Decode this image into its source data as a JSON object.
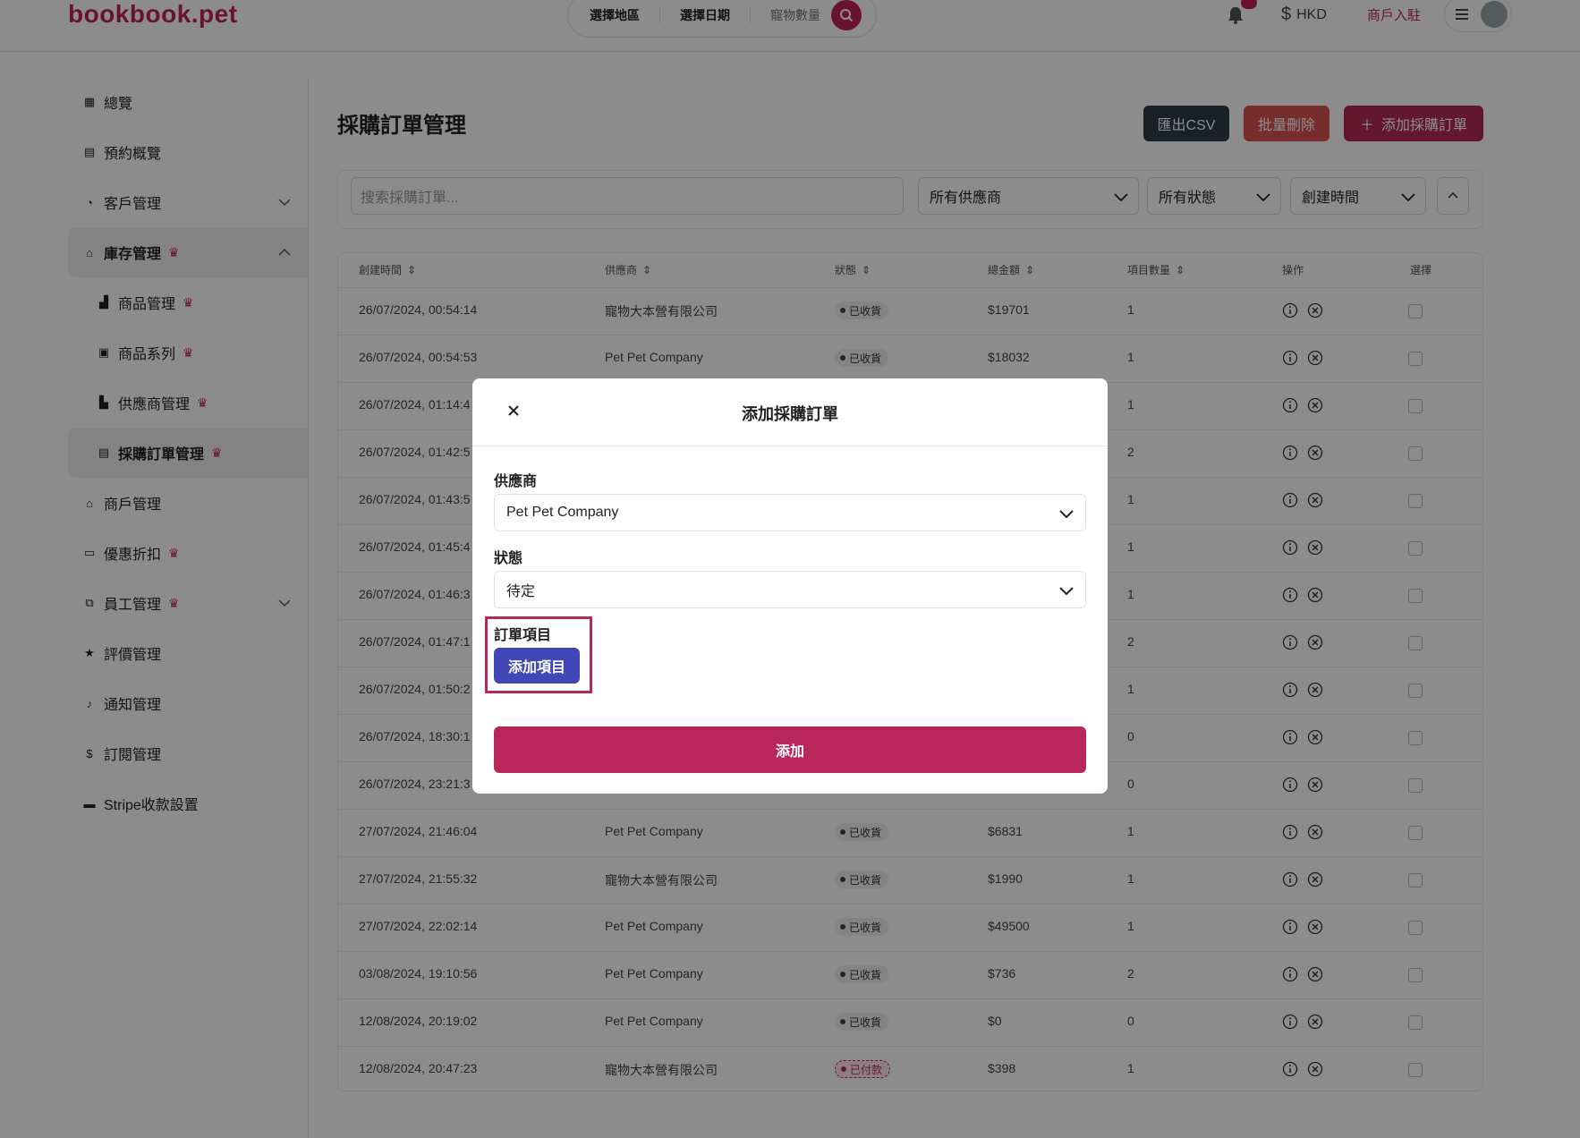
{
  "header": {
    "logo": "bookbook.pet",
    "search": {
      "area": "選擇地區",
      "date": "選擇日期",
      "pets": "寵物數量"
    },
    "currency": "HKD",
    "merchant_link": "商戶入駐"
  },
  "sidebar": {
    "items": [
      {
        "label": "總覽",
        "icon": "grid-icon"
      },
      {
        "label": "預約概覽",
        "icon": "calendar-icon"
      },
      {
        "label": "客戶管理",
        "icon": "headset-icon"
      },
      {
        "label": "庫存管理",
        "icon": "store-icon"
      },
      {
        "label": "商品管理",
        "icon": "boxes-icon"
      },
      {
        "label": "商品系列",
        "icon": "archive-icon"
      },
      {
        "label": "供應商管理",
        "icon": "factory-icon"
      },
      {
        "label": "採購訂單管理",
        "icon": "calendar-icon"
      },
      {
        "label": "商戶管理",
        "icon": "store-icon"
      },
      {
        "label": "優惠折扣",
        "icon": "ticket-icon"
      },
      {
        "label": "員工管理",
        "icon": "org-icon"
      },
      {
        "label": "評價管理",
        "icon": "star-icon"
      },
      {
        "label": "通知管理",
        "icon": "bell-icon"
      },
      {
        "label": "訂閱管理",
        "icon": "dollar-icon"
      },
      {
        "label": "Stripe收款設置",
        "icon": "stripe-icon"
      }
    ]
  },
  "main": {
    "title": "採購訂單管理",
    "buttons": {
      "export": "匯出CSV",
      "bulk_delete": "批量刪除",
      "add": "添加採購訂單"
    },
    "filters": {
      "search_placeholder": "搜索採購訂單...",
      "supplier": "所有供應商",
      "status": "所有狀態",
      "sort": "創建時間"
    },
    "table": {
      "headers": [
        "創建時間",
        "供應商",
        "狀態",
        "總金額",
        "項目數量",
        "操作",
        "選擇"
      ],
      "rows": [
        {
          "created": "26/07/2024, 00:54:14",
          "supplier": "寵物大本營有限公司",
          "status": "已收貨",
          "amount": "$19701",
          "count": "1"
        },
        {
          "created": "26/07/2024, 00:54:53",
          "supplier": "Pet Pet Company",
          "status": "已收貨",
          "amount": "$18032",
          "count": "1"
        },
        {
          "created": "26/07/2024, 01:14:4",
          "supplier": "",
          "status": "",
          "amount": "",
          "count": "1"
        },
        {
          "created": "26/07/2024, 01:42:5",
          "supplier": "",
          "status": "",
          "amount": "",
          "count": "2"
        },
        {
          "created": "26/07/2024, 01:43:5",
          "supplier": "",
          "status": "",
          "amount": "",
          "count": "1"
        },
        {
          "created": "26/07/2024, 01:45:4",
          "supplier": "",
          "status": "",
          "amount": "",
          "count": "1"
        },
        {
          "created": "26/07/2024, 01:46:3",
          "supplier": "",
          "status": "",
          "amount": "",
          "count": "1"
        },
        {
          "created": "26/07/2024, 01:47:1",
          "supplier": "",
          "status": "",
          "amount": "",
          "count": "2"
        },
        {
          "created": "26/07/2024, 01:50:2",
          "supplier": "",
          "status": "",
          "amount": "",
          "count": "1"
        },
        {
          "created": "26/07/2024, 18:30:1",
          "supplier": "",
          "status": "",
          "amount": "",
          "count": "0"
        },
        {
          "created": "26/07/2024, 23:21:3",
          "supplier": "",
          "status": "",
          "amount": "",
          "count": "0"
        },
        {
          "created": "27/07/2024, 21:46:04",
          "supplier": "Pet Pet Company",
          "status": "已收貨",
          "amount": "$6831",
          "count": "1"
        },
        {
          "created": "27/07/2024, 21:55:32",
          "supplier": "寵物大本營有限公司",
          "status": "已收貨",
          "amount": "$1990",
          "count": "1"
        },
        {
          "created": "27/07/2024, 22:02:14",
          "supplier": "Pet Pet Company",
          "status": "已收貨",
          "amount": "$49500",
          "count": "1"
        },
        {
          "created": "03/08/2024, 19:10:56",
          "supplier": "Pet Pet Company",
          "status": "已收貨",
          "amount": "$736",
          "count": "2"
        },
        {
          "created": "12/08/2024, 20:19:02",
          "supplier": "Pet Pet Company",
          "status": "已收貨",
          "amount": "$0",
          "count": "0"
        },
        {
          "created": "12/08/2024, 20:47:23",
          "supplier": "寵物大本營有限公司",
          "status": "已付款",
          "amount": "$398",
          "count": "1"
        }
      ]
    }
  },
  "modal": {
    "title": "添加採購訂單",
    "supplier_label": "供應商",
    "supplier_value": "Pet Pet Company",
    "status_label": "狀態",
    "status_value": "待定",
    "items_label": "訂單項目",
    "add_item": "添加項目",
    "submit": "添加"
  },
  "colors": {
    "brand": "#c0245a",
    "indigo": "#3f48b6"
  }
}
